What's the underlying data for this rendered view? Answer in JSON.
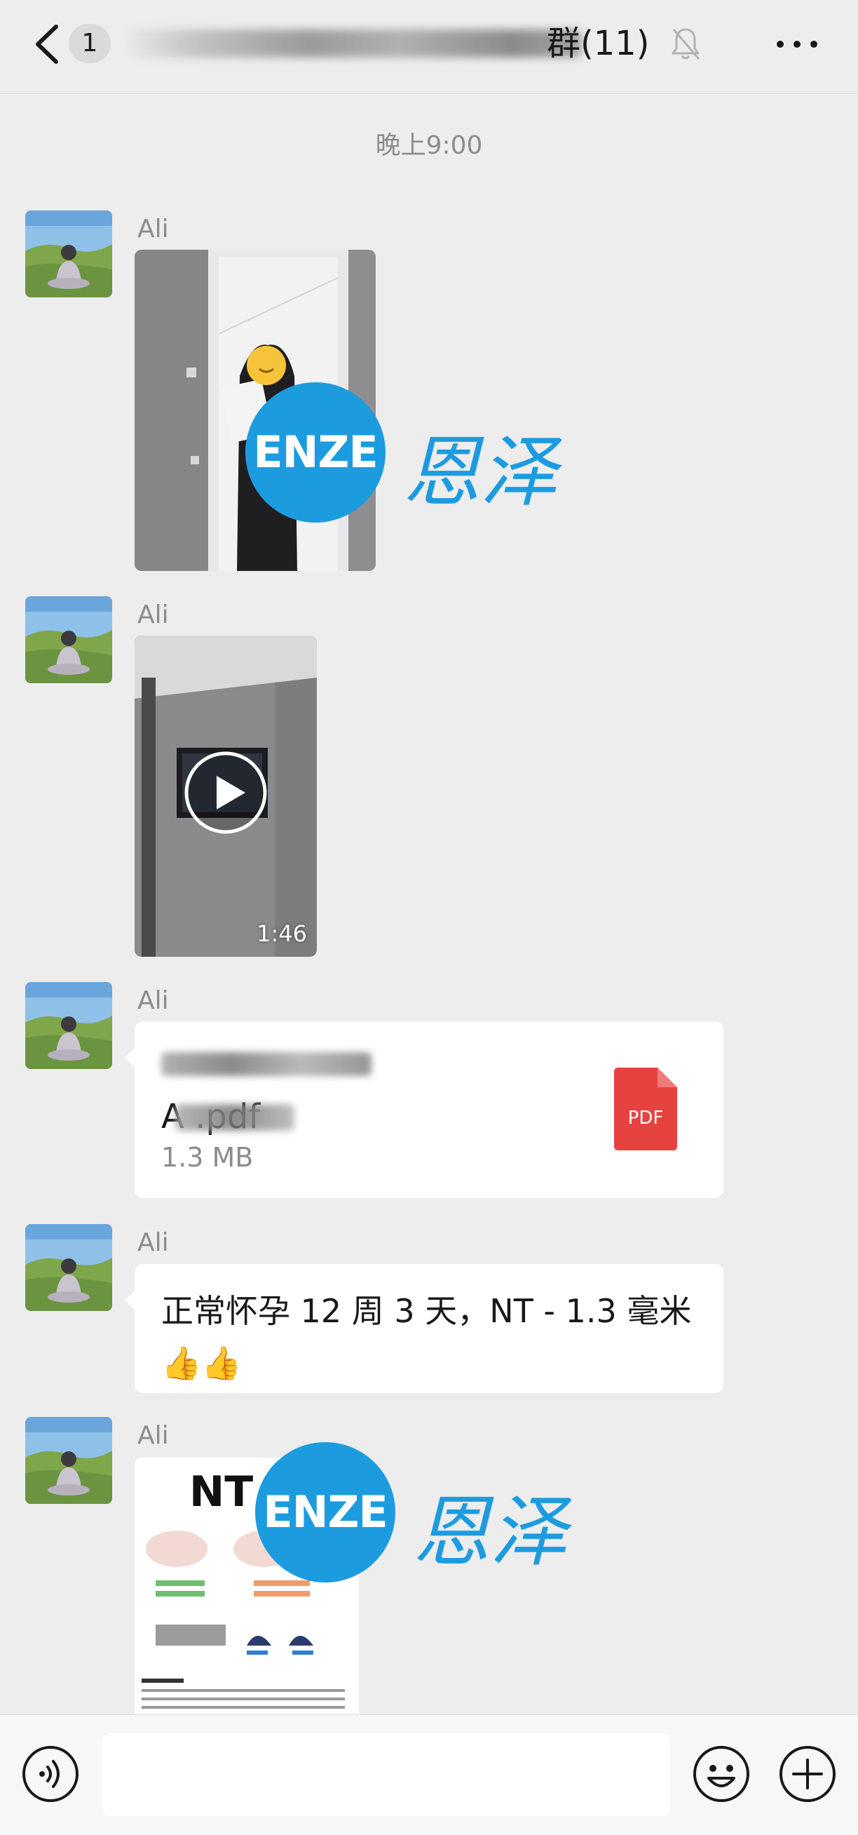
{
  "header": {
    "unread_count": "1",
    "title_visible": "群(11)"
  },
  "timestamp": "晚上9:00",
  "messages": [
    {
      "sender": "Ali",
      "type": "image"
    },
    {
      "sender": "Ali",
      "type": "video",
      "duration": "1:46"
    },
    {
      "sender": "Ali",
      "type": "file",
      "file_name_visible": "A .pdf",
      "file_size": "1.3 MB",
      "file_type_label": "PDF"
    },
    {
      "sender": "Ali",
      "type": "text",
      "text": "正常怀孕 12 周 3 天，NT - 1.3 毫米 👍👍"
    },
    {
      "sender": "Ali",
      "type": "image",
      "image_text": "NT"
    }
  ],
  "watermark": {
    "latin": "ENZE",
    "chinese": "恩泽"
  },
  "icons": {
    "back": "chevron-left-icon",
    "mute": "bell-off-icon",
    "more": "more-horizontal-icon",
    "voice": "voice-icon",
    "emoji": "emoji-icon",
    "plus": "plus-circle-icon",
    "play": "play-icon",
    "pdf": "pdf-file-icon"
  },
  "colors": {
    "background": "#ededed",
    "bubble": "#ffffff",
    "brand_blue": "#1d9bdf",
    "pdf_red": "#e64340",
    "muted_text": "#8c8c8c"
  }
}
